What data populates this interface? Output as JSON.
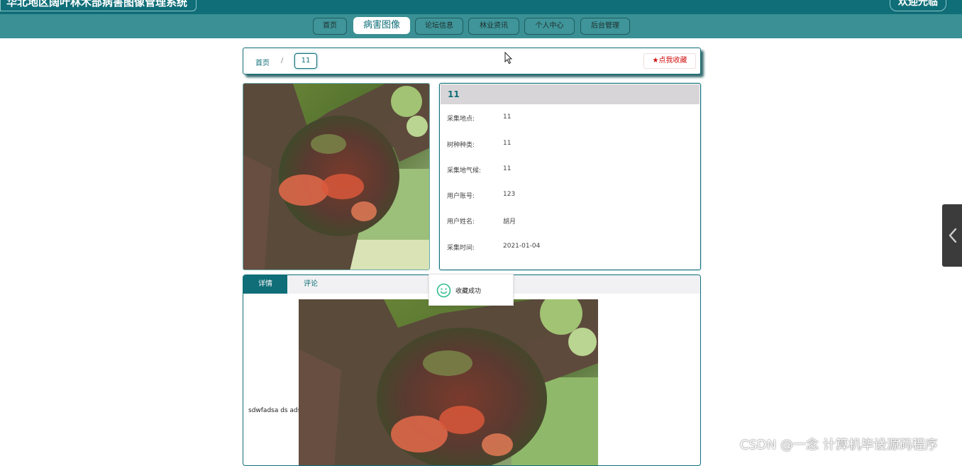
{
  "header": {
    "site_title": "华北地区阔叶林木部病害图像管理系统",
    "welcome": "欢迎光临"
  },
  "nav": {
    "items": [
      {
        "label": "首页",
        "active": false
      },
      {
        "label": "病害图像",
        "active": true
      },
      {
        "label": "论坛信息",
        "active": false
      },
      {
        "label": "林业资讯",
        "active": false
      },
      {
        "label": "个人中心",
        "active": false
      },
      {
        "label": "后台管理",
        "active": false
      }
    ]
  },
  "breadcrumb": {
    "home": "首页",
    "separator": "/",
    "current": "11"
  },
  "favorite_button": "★点我收藏",
  "detail": {
    "title": "11",
    "fields": [
      {
        "label": "采集地点:",
        "value": "11"
      },
      {
        "label": "树种种类:",
        "value": "11"
      },
      {
        "label": "采集地气候:",
        "value": "11"
      },
      {
        "label": "用户账号:",
        "value": "123"
      },
      {
        "label": "用户姓名:",
        "value": "胡月"
      },
      {
        "label": "采集时间:",
        "value": "2021-01-04"
      }
    ]
  },
  "tabs": [
    {
      "label": "详情",
      "active": true
    },
    {
      "label": "评论",
      "active": false
    }
  ],
  "description": "sdwfadsa ds ads",
  "toast": {
    "message": "收藏成功",
    "icon": "smile-icon"
  },
  "side_toggle_icon": "chevron-left-icon",
  "watermark": "CSDN @一念 计算机毕设源码程序",
  "colors": {
    "primary": "#0f6e78",
    "nav_bar": "#3a9094",
    "favorite_red": "#d31010",
    "toast_green": "#2fbf8f"
  }
}
